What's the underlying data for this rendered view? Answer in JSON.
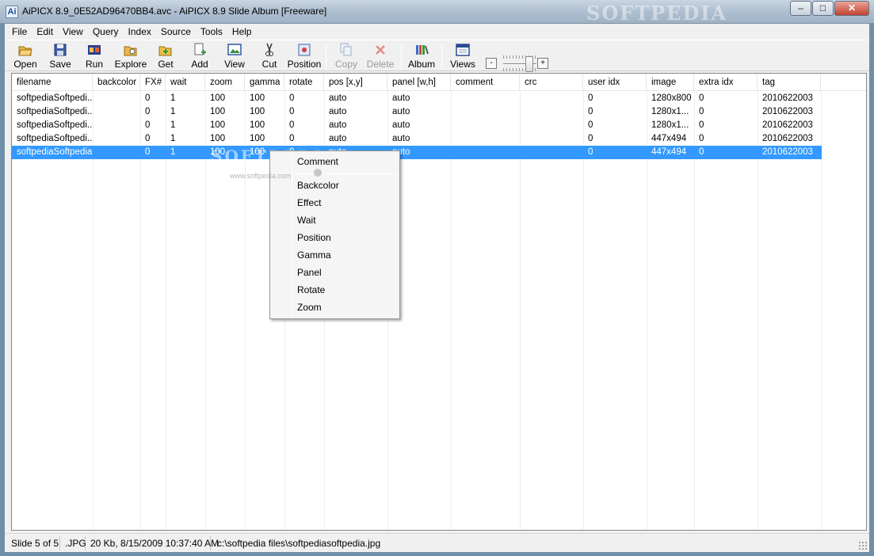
{
  "window": {
    "title": "AiPICX 8.9_0E52AD96470BB4.avc - AiPICX 8.9 Slide Album  [Freeware]",
    "icon_text": "Ai",
    "watermark": "SOFTPEDIA",
    "minimize": "–",
    "maximize": "□",
    "close": "✕"
  },
  "menu": [
    "File",
    "Edit",
    "View",
    "Query",
    "Index",
    "Source",
    "Tools",
    "Help"
  ],
  "toolbar": {
    "buttons": [
      {
        "label": "Open",
        "icon": "folder-open-icon",
        "enabled": true
      },
      {
        "label": "Save",
        "icon": "floppy-disk-icon",
        "enabled": true
      },
      {
        "label": "Run",
        "icon": "film-strip-icon",
        "enabled": true
      },
      {
        "label": "Explore",
        "icon": "folder-explore-icon",
        "enabled": true
      },
      {
        "label": "Get",
        "icon": "folder-get-icon",
        "enabled": true
      },
      {
        "label": "Add",
        "icon": "add-document-icon",
        "enabled": true
      },
      {
        "label": "View",
        "icon": "picture-view-icon",
        "enabled": true
      },
      {
        "label": "Cut",
        "icon": "scissors-icon",
        "enabled": true
      },
      {
        "label": "Position",
        "icon": "position-grid-icon",
        "enabled": true
      },
      {
        "label": "Copy",
        "icon": "copy-icon",
        "enabled": false
      },
      {
        "label": "Delete",
        "icon": "delete-x-icon",
        "enabled": false
      },
      {
        "label": "Album",
        "icon": "album-icon",
        "enabled": true
      },
      {
        "label": "Views",
        "icon": "views-window-icon",
        "enabled": true
      }
    ],
    "zoom_minus": "-",
    "zoom_plus": "+",
    "zoom_level": 0.7
  },
  "table": {
    "columns": [
      "filename",
      "backcolor",
      "FX#",
      "wait",
      "zoom",
      "gamma",
      "rotate",
      "pos [x,y]",
      "panel [w,h]",
      "comment",
      "crc",
      "user idx",
      "image",
      "extra idx",
      "tag"
    ],
    "rows": [
      [
        "softpediaSoftpedi...",
        "",
        "0",
        "1",
        "100",
        "100",
        "0",
        "auto",
        "auto",
        "",
        "",
        "0",
        "1280x800",
        "0",
        "2010622003"
      ],
      [
        "softpediaSoftpedi...",
        "",
        "0",
        "1",
        "100",
        "100",
        "0",
        "auto",
        "auto",
        "",
        "",
        "0",
        "1280x1...",
        "0",
        "2010622003"
      ],
      [
        "softpediaSoftpedi...",
        "",
        "0",
        "1",
        "100",
        "100",
        "0",
        "auto",
        "auto",
        "",
        "",
        "0",
        "1280x1...",
        "0",
        "2010622003"
      ],
      [
        "softpediaSoftpedi...",
        "",
        "0",
        "1",
        "100",
        "100",
        "0",
        "auto",
        "auto",
        "",
        "",
        "0",
        "447x494",
        "0",
        "2010622003"
      ],
      [
        "softpediaSoftpedia",
        "",
        "0",
        "1",
        "100",
        "100",
        "0",
        "auto",
        "auto",
        "",
        "",
        "0",
        "447x494",
        "0",
        "2010622003"
      ]
    ],
    "selected_row": 4
  },
  "context_menu": {
    "header": "Comment",
    "items": [
      "Backcolor",
      "Effect",
      "Wait",
      "Position",
      "Gamma",
      "Panel",
      "Rotate",
      "Zoom"
    ],
    "watermark_small": "www.softpedia.com"
  },
  "status": {
    "slide": "Slide 5 of 5",
    "ext": ".JPG",
    "info": "20 Kb, 8/15/2009 10:37:40 AM",
    "path": "c:\\softpedia files\\softpediasoftpedia.jpg"
  }
}
